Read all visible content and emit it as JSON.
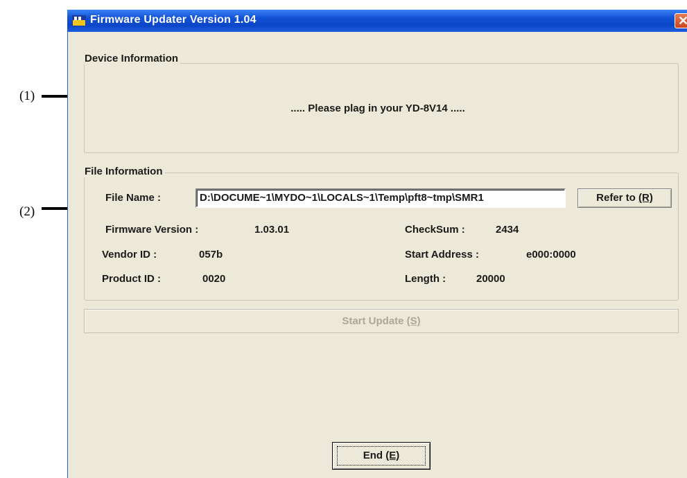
{
  "callouts": {
    "c1": "(1)",
    "c2": "(2)"
  },
  "window": {
    "title": "Firmware Updater Version 1.04",
    "close_glyph": "✕"
  },
  "device_info": {
    "group_title": "Device Information",
    "status": "..... Please plag in your YD-8V14 ....."
  },
  "file_info": {
    "group_title": "File Information",
    "file_name_label": "File Name :",
    "file_name_value": "D:\\DOCUME~1\\MYDO~1\\LOCALS~1\\Temp\\pft8~tmp\\SMR1",
    "refer_button": {
      "text": "Refer to ",
      "mnemonic": "(R)"
    },
    "firmware_version_label": "Firmware Version :",
    "firmware_version_value": "1.03.01",
    "vendor_id_label": "Vendor ID :",
    "vendor_id_value": "057b",
    "product_id_label": "Product ID :",
    "product_id_value": "0020",
    "checksum_label": "CheckSum :",
    "checksum_value": "2434",
    "start_address_label": "Start Address :",
    "start_address_value": "e000:0000",
    "length_label": "Length :",
    "length_value": "20000"
  },
  "start_button": {
    "text": "Start Update ",
    "mnemonic": "(S)",
    "enabled": false
  },
  "end_button": {
    "text": "End ",
    "mnemonic": "(E)"
  },
  "colors": {
    "titlebar": "#0b46c8",
    "window_bg": "#ece9d8",
    "close": "#c8461f"
  }
}
